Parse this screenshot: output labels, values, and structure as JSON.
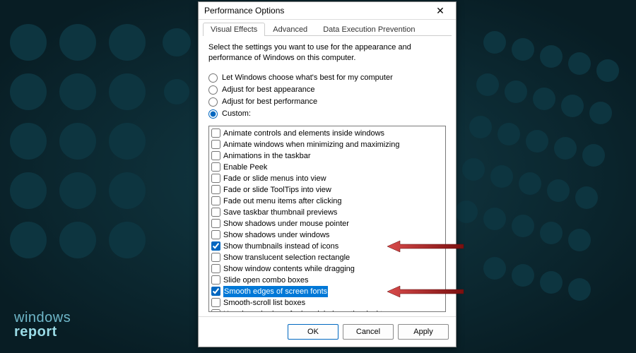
{
  "window": {
    "title": "Performance Options",
    "close_glyph": "✕"
  },
  "tabs": [
    {
      "label": "Visual Effects",
      "active": true
    },
    {
      "label": "Advanced",
      "active": false
    },
    {
      "label": "Data Execution Prevention",
      "active": false
    }
  ],
  "description": "Select the settings you want to use for the appearance and performance of Windows on this computer.",
  "radios": [
    {
      "id": "auto",
      "label": "Let Windows choose what's best for my computer",
      "checked": false
    },
    {
      "id": "bestapp",
      "label": "Adjust for best appearance",
      "checked": false
    },
    {
      "id": "bestperf",
      "label": "Adjust for best performance",
      "checked": false
    },
    {
      "id": "custom",
      "label": "Custom:",
      "checked": true
    }
  ],
  "options": [
    {
      "label": "Animate controls and elements inside windows",
      "checked": false
    },
    {
      "label": "Animate windows when minimizing and maximizing",
      "checked": false
    },
    {
      "label": "Animations in the taskbar",
      "checked": false
    },
    {
      "label": "Enable Peek",
      "checked": false
    },
    {
      "label": "Fade or slide menus into view",
      "checked": false
    },
    {
      "label": "Fade or slide ToolTips into view",
      "checked": false
    },
    {
      "label": "Fade out menu items after clicking",
      "checked": false
    },
    {
      "label": "Save taskbar thumbnail previews",
      "checked": false
    },
    {
      "label": "Show shadows under mouse pointer",
      "checked": false
    },
    {
      "label": "Show shadows under windows",
      "checked": false
    },
    {
      "label": "Show thumbnails instead of icons",
      "checked": true,
      "arrow": true
    },
    {
      "label": "Show translucent selection rectangle",
      "checked": false
    },
    {
      "label": "Show window contents while dragging",
      "checked": false
    },
    {
      "label": "Slide open combo boxes",
      "checked": false
    },
    {
      "label": "Smooth edges of screen fonts",
      "checked": true,
      "selected": true,
      "arrow": true
    },
    {
      "label": "Smooth-scroll list boxes",
      "checked": false
    },
    {
      "label": "Use drop shadows for icon labels on the desktop",
      "checked": false
    }
  ],
  "buttons": {
    "ok": "OK",
    "cancel": "Cancel",
    "apply": "Apply"
  },
  "watermark": {
    "line1": "windows",
    "line2": "report"
  },
  "colors": {
    "accent": "#0067c0",
    "selection": "#0078d7",
    "arrow": "#a11d1d"
  }
}
